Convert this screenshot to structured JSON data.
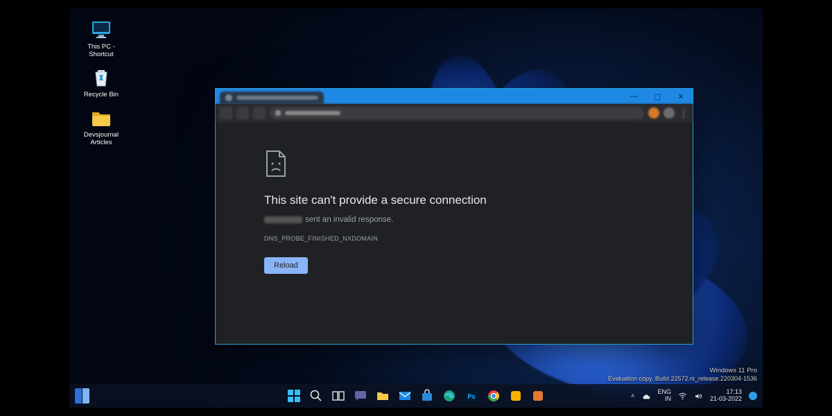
{
  "desktop_icons": {
    "thispc": "This PC - Shortcut",
    "recyclebin": "Recycle Bin",
    "folder": "Devsjournal Articles"
  },
  "browser": {
    "error_title": "This site can't provide a secure connection",
    "error_subtext": "sent an invalid response.",
    "error_code": "DNS_PROBE_FINISHED_NXDOMAIN",
    "reload_label": "Reload"
  },
  "watermark": {
    "line1": "Windows 11 Pro",
    "line2": "Evaluation copy. Build 22572.ni_release.220304-1536"
  },
  "systray": {
    "lang_top": "ENG",
    "lang_bottom": "IN",
    "time": "17:13",
    "date": "21-03-2022"
  }
}
